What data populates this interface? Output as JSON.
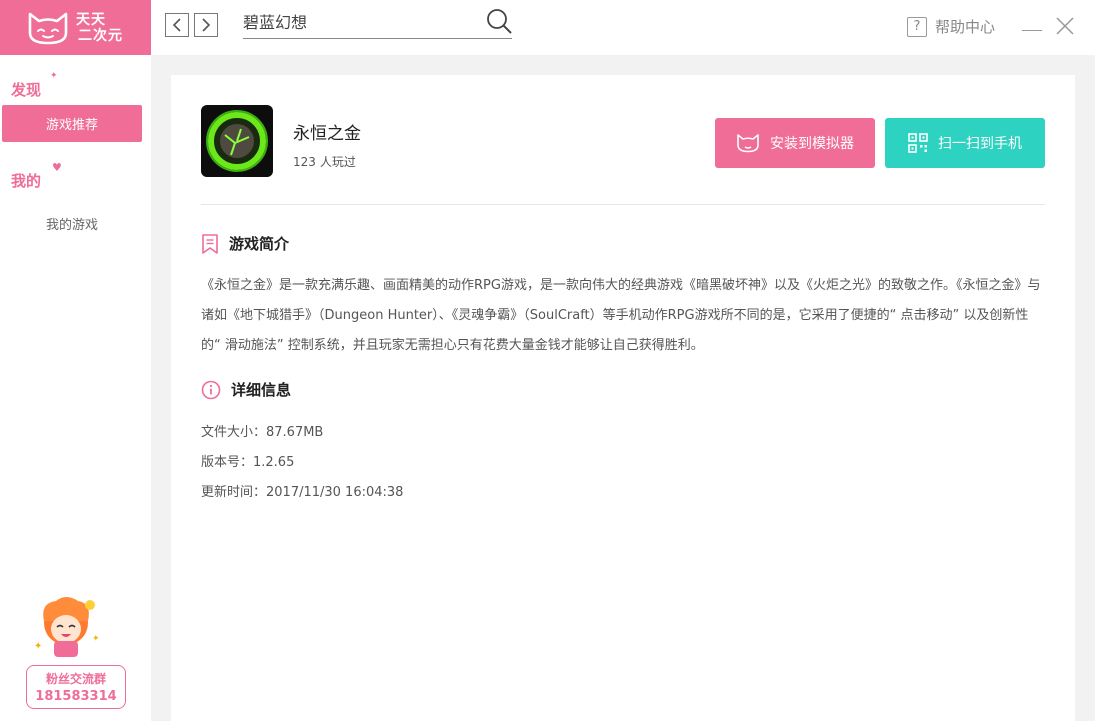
{
  "app": {
    "logo_line1": "天天",
    "logo_line2": "二次元"
  },
  "topbar": {
    "search_value": "碧蓝幻想",
    "help_label": "帮助中心",
    "help_icon_glyph": "?"
  },
  "sidebar": {
    "section_discover": "发现",
    "item_recommend": "游戏推荐",
    "section_mine": "我的",
    "item_my_games": "我的游戏",
    "fan_group_label": "粉丝交流群",
    "fan_group_number": "181583314"
  },
  "game": {
    "name": "永恒之金",
    "play_count": "123",
    "play_suffix": "人玩过",
    "install_button": "安装到模拟器",
    "scan_button": "扫一扫到手机"
  },
  "intro": {
    "title": "游戏简介",
    "text": "《永恒之金》是一款充满乐趣、画面精美的动作RPG游戏，是一款向伟大的经典游戏《暗黑破坏神》以及《火炬之光》的致敬之作。《永恒之金》与诸如《地下城猎手》（Dungeon Hunter）、《灵魂争霸》（SoulCraft）等手机动作RPG游戏所不同的是，它采用了便捷的“ 点击移动” 以及创新性的“ 滑动施法” 控制系统，并且玩家无需担心只有花费大量金钱才能够让自己获得胜利。"
  },
  "details": {
    "title": "详细信息",
    "file_size": "文件大小：87.67MB",
    "version": "版本号：1.2.65",
    "updated": "更新时间：2017/11/30 16:04:38"
  },
  "colors": {
    "brand_pink": "#f06d97",
    "accent_teal": "#2ed2c0"
  }
}
